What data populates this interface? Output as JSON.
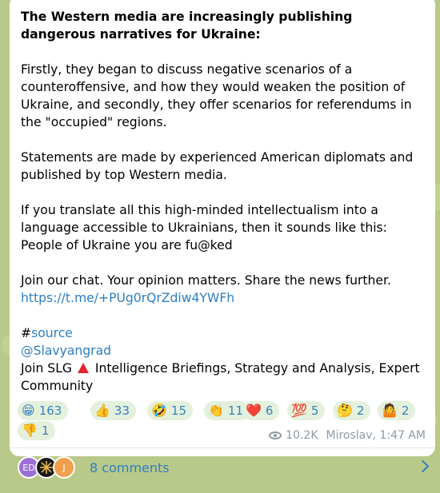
{
  "post": {
    "headline": "The Western media are increasingly publishing dangerous narratives for Ukraine:",
    "paragraph1": "Firstly, they began to discuss negative scenarios of a counteroffensive, and how they would weaken the position of Ukraine, and secondly, they offer scenarios for referendums in the \"occupied\" regions.",
    "paragraph2": "Statements are made by experienced American diplomats and published by top Western media.",
    "paragraph3": "If you translate all this high-minded intellectualism into a language accessible to Ukrainians, then it sounds like this: People of Ukraine you are fu@ked",
    "join_chat_text": "Join our chat. Your opinion matters. Share the news further.",
    "chat_link": "https://t.me/+PUg0rQrZdiw4YWFh",
    "hashtag": "#source",
    "channel_mention": "@Slavyangrad",
    "join_slg_before": "Join SLG",
    "join_slg_after": "Intelligence Briefings, Strategy and Analysis, Expert Community",
    "triangle_icon": "red-triangle-icon"
  },
  "reactions": [
    {
      "emoji": "😁",
      "count": "163",
      "icon": "grin-emoji"
    },
    {
      "emoji": "👍",
      "count": "33",
      "icon": "thumbs-up-emoji"
    },
    {
      "emoji": "🤣",
      "count": "15",
      "icon": "rofl-emoji"
    },
    {
      "emoji": "👏",
      "count": "11",
      "icon": "clap-emoji"
    },
    {
      "emoji": "❤️",
      "count": "6",
      "icon": "heart-emoji"
    },
    {
      "emoji": "💯",
      "count": "5",
      "icon": "hundred-emoji"
    },
    {
      "emoji": "🤔",
      "count": "2",
      "icon": "thinking-emoji"
    },
    {
      "emoji": "🤷",
      "count": "2",
      "icon": "shrug-emoji"
    },
    {
      "emoji": "👎",
      "count": "1",
      "icon": "thumbs-down-emoji"
    }
  ],
  "meta": {
    "views": "10.2K",
    "author_time": "Miroslav, 1:47 AM",
    "icon": "eye-icon"
  },
  "comments": {
    "label": "8 comments",
    "avatars": [
      {
        "text": "ED",
        "color": "#9b6fd6"
      },
      {
        "text": "",
        "color": "#1a1a1a"
      },
      {
        "text": "J",
        "color": "#f0a04b"
      }
    ],
    "chevron_icon": "chevron-right-icon"
  },
  "colors": {
    "link": "#2e7fc1",
    "reaction_bg": "#e3f1dc",
    "background": "#b9c98a"
  }
}
